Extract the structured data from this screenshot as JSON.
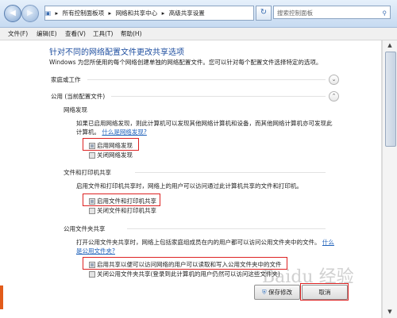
{
  "address": {
    "segments": [
      "所有控制面板项",
      "网络和共享中心",
      "高级共享设置"
    ],
    "search_placeholder": "搜索控制面板"
  },
  "menu": [
    "文件(F)",
    "编辑(E)",
    "查看(V)",
    "工具(T)",
    "帮助(H)"
  ],
  "page": {
    "title": "针对不同的网络配置文件更改共享选项",
    "description": "Windows 为您所使用的每个网络创建单独的网络配置文件。您可以针对每个配置文件选择特定的选项。",
    "profile_home": "家庭或工作",
    "profile_public": "公用 (当前配置文件)"
  },
  "discovery": {
    "heading": "网络发现",
    "desc1": "如果已启用网络发现，则此计算机可以发现其他网络计算机和设备，而其他网络计算机亦可发现此",
    "desc2": "计算机。",
    "link": "什么是网络发现?",
    "opt_on": "启用网络发现",
    "opt_off": "关闭网络发现"
  },
  "file_sharing": {
    "heading": "文件和打印机共享",
    "desc": "启用文件和打印机共享时，网络上的用户可以访问通过此计算机共享的文件和打印机。",
    "opt_on": "启用文件和打印机共享",
    "opt_off": "关闭文件和打印机共享"
  },
  "public_folder": {
    "heading": "公用文件夹共享",
    "desc1": "打开公用文件夹共享时，网络上包括家庭组成员在内的用户都可以访问公用文件夹中的文件。",
    "link1": "什么",
    "link2": "是公用文件夹?",
    "opt_on": "启用共享以便可以访问网络的用户可以读取和写入公用文件夹中的文件",
    "opt_off": "关闭公用文件夹共享(登录到此计算机的用户仍然可以访问这些文件夹)"
  },
  "buttons": {
    "save": "保存修改",
    "cancel": "取消"
  },
  "watermark": "Baidu 经验"
}
